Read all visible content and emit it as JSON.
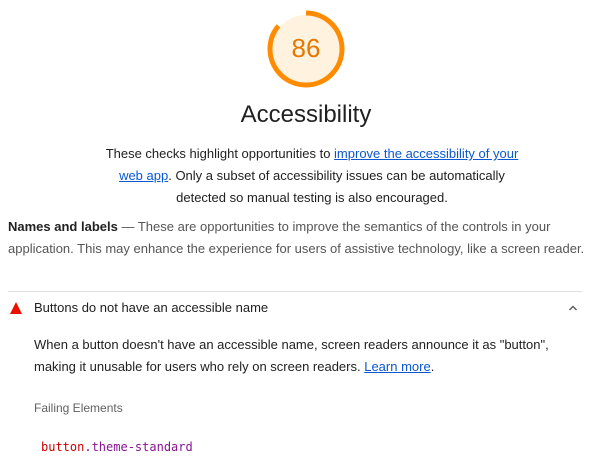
{
  "score": {
    "value": "86",
    "fraction": 0.86,
    "color": "#ff8c00",
    "bg_color": "#fff3e0",
    "text_color": "#e67700"
  },
  "category": {
    "title": "Accessibility",
    "desc_pre": "These checks highlight opportunities to ",
    "desc_link": "improve the accessibility of your web app",
    "desc_post": ". Only a subset of accessibility issues can be automatically detected so manual testing is also encouraged."
  },
  "group": {
    "title": "Names and labels",
    "separator": "—",
    "description": "These are opportunities to improve the semantics of the controls in your application. This may enhance the experience for users of assistive technology, like a screen reader."
  },
  "audit": {
    "status_icon": "fail-triangle-icon",
    "fail_color": "#eb0f00",
    "title": "Buttons do not have an accessible name",
    "desc_pre": "When a button doesn't have an accessible name, screen readers announce it as \"button\", making it unusable for users who rely on screen readers. ",
    "desc_link": "Learn more",
    "desc_post": ".",
    "failing_label": "Failing Elements",
    "failing_node_tag": "button",
    "failing_node_class": ".theme-standard"
  }
}
